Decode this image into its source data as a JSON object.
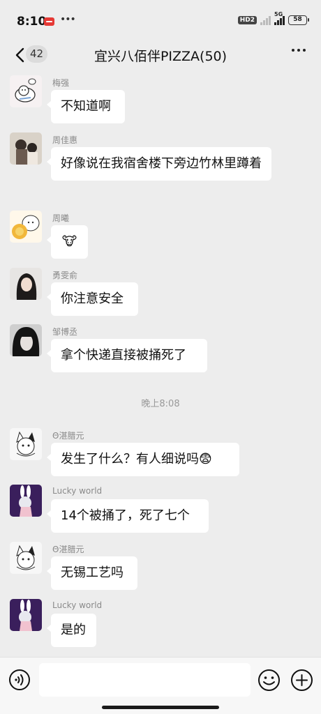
{
  "status_bar": {
    "time": "8:10",
    "hd_badge": "HD2",
    "network": "5G",
    "battery": "58"
  },
  "header": {
    "back_count": "42",
    "title": "宜兴八佰伴PIZZA(50)"
  },
  "messages": [
    {
      "sender": "梅强",
      "text": "不知道啊"
    },
    {
      "sender": "周佳惠",
      "text": "好像说在我宿舍楼下旁边竹林里蹲着"
    },
    {
      "sender": "周曦",
      "text": "🐮"
    },
    {
      "sender": "勇雯俞",
      "text": "你注意安全"
    },
    {
      "sender": "邹博丞",
      "text": "拿个快递直接被捅死了"
    },
    {
      "sender": "Θ湛腊元",
      "text": "发生了什么？有人细说吗😨"
    },
    {
      "sender": "Lucky world",
      "text": "14个被捅了，死了七个"
    },
    {
      "sender": "Θ湛腊元",
      "text": "无锡工艺吗"
    },
    {
      "sender": "Lucky world",
      "text": "是的"
    }
  ],
  "time_separator": "晚上8:08",
  "input": {
    "value": "",
    "placeholder": ""
  },
  "icons": {
    "back": "chevron-left-icon",
    "more": "more-dots-icon",
    "voice": "voice-icon",
    "emoji": "emoji-icon",
    "plus": "plus-icon"
  }
}
